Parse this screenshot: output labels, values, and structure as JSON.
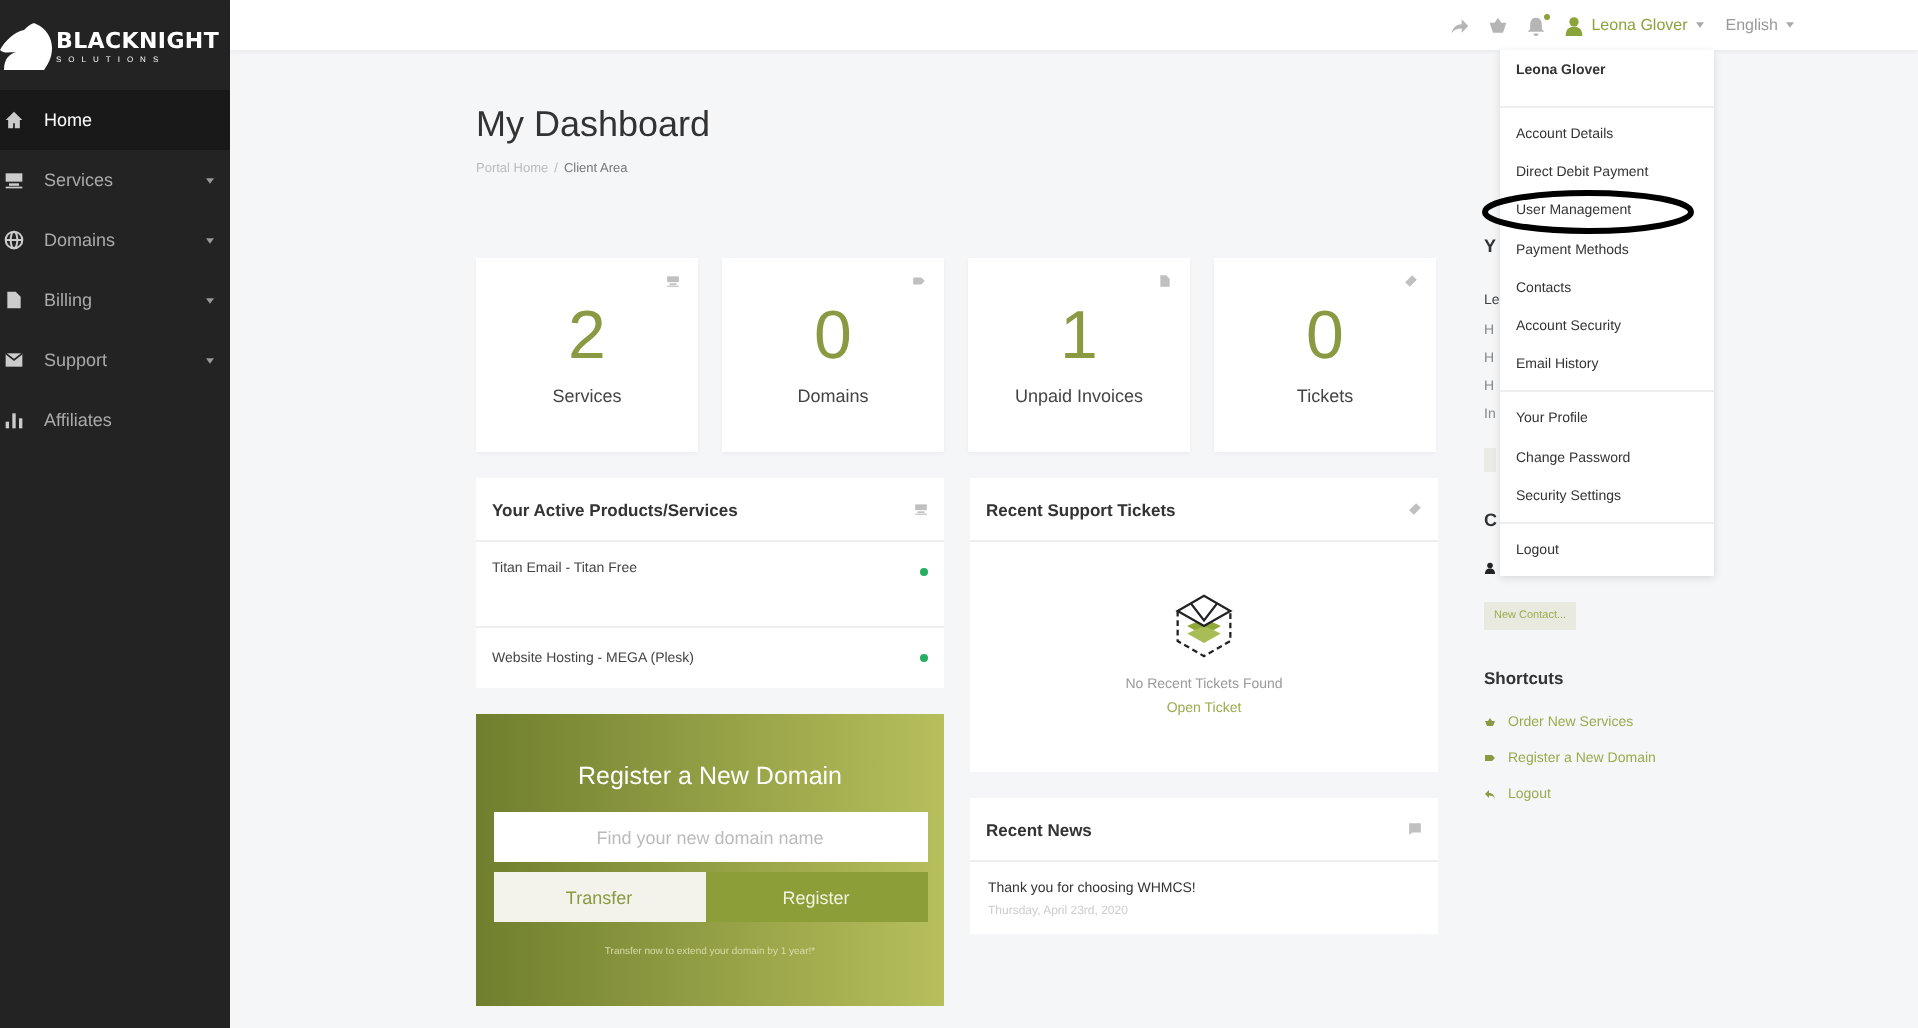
{
  "logo": {
    "name": "BLACKNIGHT",
    "tagline": "SOLUTIONS"
  },
  "sidebar": {
    "items": [
      {
        "label": "Home",
        "selected": true,
        "has_submenu": false
      },
      {
        "label": "Services",
        "selected": false,
        "has_submenu": true
      },
      {
        "label": "Domains",
        "selected": false,
        "has_submenu": true
      },
      {
        "label": "Billing",
        "selected": false,
        "has_submenu": true
      },
      {
        "label": "Support",
        "selected": false,
        "has_submenu": true
      },
      {
        "label": "Affiliates",
        "selected": false,
        "has_submenu": false
      }
    ]
  },
  "topbar": {
    "user": "Leona Glover",
    "language": "English",
    "notification_dot": true
  },
  "page": {
    "title": "My Dashboard",
    "separator": "/",
    "breadcrumb": [
      {
        "label": "Portal Home",
        "current": false
      },
      {
        "label": "Client Area",
        "current": true
      }
    ]
  },
  "stats": [
    {
      "value": "2",
      "label": "Services"
    },
    {
      "value": "0",
      "label": "Domains"
    },
    {
      "value": "1",
      "label": "Unpaid Invoices"
    },
    {
      "value": "0",
      "label": "Tickets"
    }
  ],
  "products": {
    "title": "Your Active Products/Services",
    "items": [
      {
        "name": "Titan Email - Titan Free",
        "color": "#27ae60"
      },
      {
        "name": "Website Hosting - MEGA (Plesk)",
        "color": "#27ae60"
      }
    ]
  },
  "register_domain": {
    "title": "Register a New Domain",
    "placeholder": "Find your new domain name",
    "transfer": "Transfer",
    "register": "Register",
    "note": "Transfer now to extend your domain by 1 year!*"
  },
  "tickets": {
    "title": "Recent Support Tickets",
    "empty": "No Recent Tickets Found",
    "link": "Open Ticket"
  },
  "news": {
    "title": "Recent News",
    "items": [
      {
        "headline": "Thank you for choosing WHMCS!",
        "date": "Thursday, April 23rd, 2020"
      }
    ]
  },
  "right": {
    "info_heading": "Y",
    "info_lines": [
      "Le",
      "H",
      "H",
      "H",
      "In"
    ],
    "contacts_heading": "C",
    "new_contact": "New Contact...",
    "shortcuts_title": "Shortcuts",
    "shortcuts": [
      "Order New Services",
      "Register a New Domain",
      "Logout"
    ]
  },
  "user_menu": {
    "name": "Leona Glover",
    "groups": [
      [
        {
          "label": "Account Details"
        },
        {
          "label": "Direct Debit Payment"
        },
        {
          "label": "User Management",
          "circled": true
        },
        {
          "label": "Payment Methods"
        },
        {
          "label": "Contacts"
        },
        {
          "label": "Account Security"
        },
        {
          "label": "Email History"
        }
      ],
      [
        {
          "label": "Your Profile"
        },
        {
          "label": "Change Password"
        },
        {
          "label": "Security Settings"
        }
      ],
      [
        {
          "label": "Logout"
        }
      ]
    ]
  }
}
